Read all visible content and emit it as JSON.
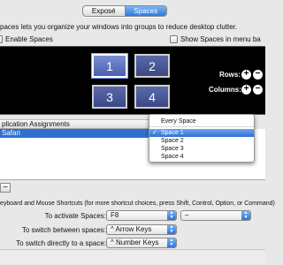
{
  "tabs": [
    {
      "label": "Exposé",
      "active": false
    },
    {
      "label": "Spaces",
      "active": true
    }
  ],
  "description": "paces lets you organize your windows into groups to reduce desktop clutter.",
  "enable_spaces_label": "Enable Spaces",
  "show_in_menu_bar_label": "Show Spaces in menu ba",
  "space_tiles": [
    "1",
    "2",
    "3",
    "4"
  ],
  "rows_label": "Rows:",
  "columns_label": "Columns:",
  "plus_glyph": "+",
  "minus_glyph": "−",
  "table": {
    "header": "plication Assignments",
    "rows": [
      {
        "app": "Safari",
        "space": "Space 1"
      }
    ]
  },
  "space_menu": {
    "items": [
      "Every Space",
      "Space 1",
      "Space 2",
      "Space 3",
      "Space 4"
    ],
    "selected": "Space 1",
    "check": "✓"
  },
  "remove_button": "−",
  "shortcuts_title": "eyboard and Mouse Shortcuts (for more shortcut choices, press Shift, Control, Option, or Command)",
  "shortcuts": [
    {
      "label": "To activate Spaces:",
      "value": "F8",
      "secondary": "–"
    },
    {
      "label": "To switch between spaces:",
      "value": "^ Arrow Keys"
    },
    {
      "label": "To switch directly to a space:",
      "value": "^ Number Keys"
    }
  ],
  "colors": {
    "accent": "#2f6fd0",
    "grid_bg": "#000000"
  }
}
